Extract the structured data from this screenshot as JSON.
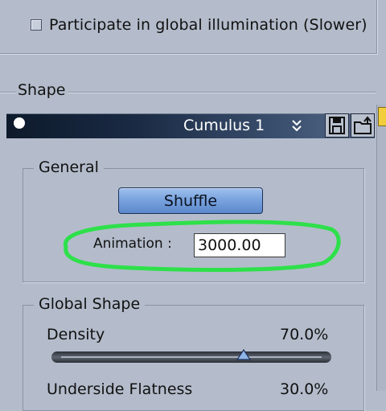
{
  "global_illumination": {
    "label": "Participate in global illumination (Slower)",
    "checked": false
  },
  "shape": {
    "section_label": "Shape",
    "preset": {
      "name": "Cumulus 1",
      "icons": [
        "dot-icon",
        "chevron-double-down-icon",
        "save-icon",
        "load-icon"
      ]
    },
    "general": {
      "label": "General",
      "shuffle_label": "Shuffle",
      "animation_label": "Animation :",
      "animation_value": "3000.00"
    },
    "global_shape": {
      "label": "Global Shape",
      "density_label": "Density",
      "density_value": "70.0%",
      "density_fraction": 0.7,
      "underside_label": "Underside Flatness",
      "underside_value": "30.0%"
    }
  },
  "colors": {
    "panel_bg": "#b4bccb",
    "header_dark": "#0d1a2b",
    "button_blue": "#7aa4df",
    "highlight_green": "#2ee04a"
  }
}
